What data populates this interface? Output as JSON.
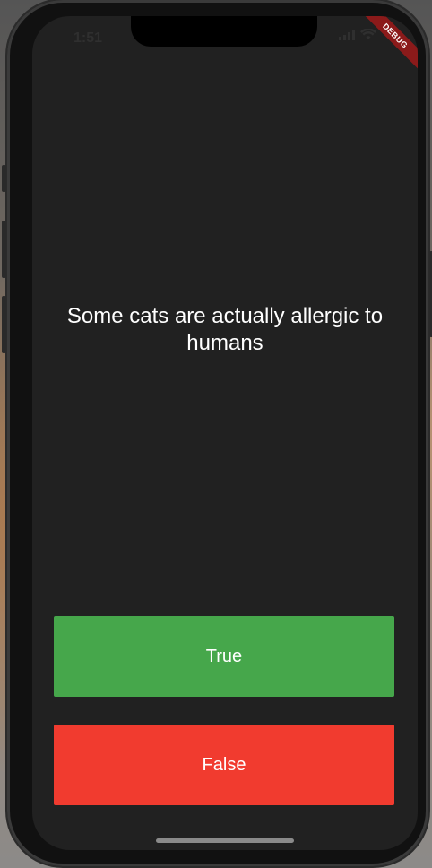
{
  "status_bar": {
    "time": "1:51"
  },
  "debug_banner": {
    "label": "DEBUG"
  },
  "quiz": {
    "question": "Some cats are actually allergic to humans"
  },
  "answers": {
    "true_label": "True",
    "false_label": "False"
  },
  "colors": {
    "screen_background": "#212121",
    "true_button": "#46A74B",
    "false_button": "#F13B2F",
    "text": "#FFFFFF"
  }
}
